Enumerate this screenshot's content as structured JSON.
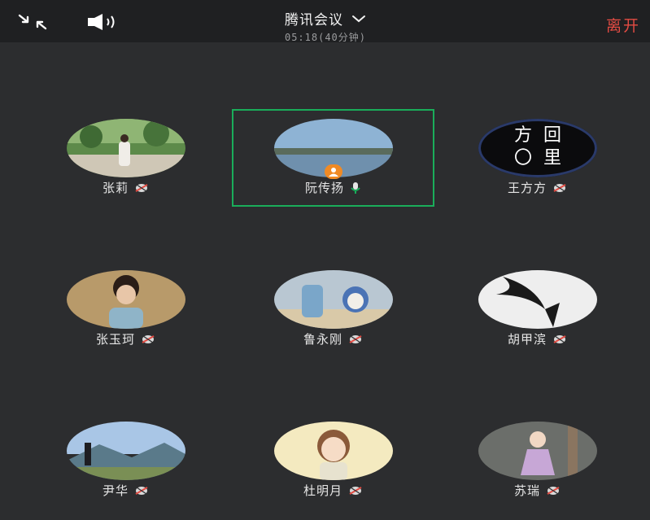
{
  "header": {
    "title": "腾讯会议",
    "timer": "05:18(40分钟)",
    "leave_label": "离开"
  },
  "participants": [
    {
      "name": "张莉",
      "mic": "muted"
    },
    {
      "name": "阮传扬",
      "mic": "active",
      "host": true,
      "selected": true
    },
    {
      "name": "王方方",
      "mic": "muted",
      "avatar_text": [
        "方",
        "回",
        "〇",
        "里"
      ]
    },
    {
      "name": "张玉珂",
      "mic": "muted"
    },
    {
      "name": "鲁永刚",
      "mic": "muted"
    },
    {
      "name": "胡甲滨",
      "mic": "muted"
    },
    {
      "name": "尹华",
      "mic": "muted"
    },
    {
      "name": "杜明月",
      "mic": "muted"
    },
    {
      "name": "苏瑞",
      "mic": "muted"
    }
  ],
  "colors": {
    "background": "#2c2d2f",
    "topbar": "#1f2022",
    "leave": "#e24b43",
    "selected_border": "#1aad5a",
    "host_badge": "#f08a24"
  },
  "icons": {
    "shrink": "shrink-arrows-icon",
    "speaker": "speaker-icon",
    "chevron": "chevron-down-icon",
    "mic_muted": "mic-muted-icon",
    "mic_active": "mic-active-icon",
    "host": "host-icon"
  }
}
